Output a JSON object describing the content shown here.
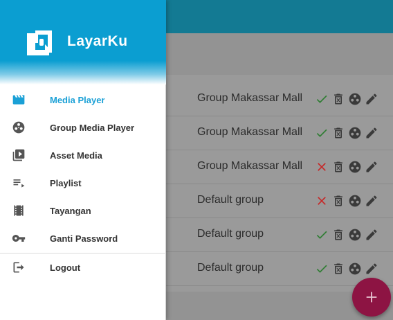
{
  "app": {
    "name": "LayarKu"
  },
  "drawer": {
    "items": [
      {
        "label": "Media Player",
        "icon": "clapperboard-icon",
        "active": true
      },
      {
        "label": "Group Media Player",
        "icon": "film-reel-icon",
        "active": false
      },
      {
        "label": "Asset Media",
        "icon": "video-library-icon",
        "active": false
      },
      {
        "label": "Playlist",
        "icon": "playlist-icon",
        "active": false
      },
      {
        "label": "Tayangan",
        "icon": "film-strip-icon",
        "active": false
      },
      {
        "label": "Ganti Password",
        "icon": "key-icon",
        "active": false
      }
    ],
    "logout_label": "Logout"
  },
  "table": {
    "rows": [
      {
        "group": "Group Makassar Mall",
        "status": "active"
      },
      {
        "group": "Group Makassar Mall",
        "status": "active"
      },
      {
        "group": "Group Makassar Mall",
        "status": "inactive"
      },
      {
        "group": "Default group",
        "status": "inactive"
      },
      {
        "group": "Default group",
        "status": "active"
      },
      {
        "group": "Default group",
        "status": "active"
      }
    ]
  },
  "colors": {
    "primary": "#0b9ed1",
    "accent": "#8d1443",
    "ok": "#2e7d32",
    "bad": "#c62828"
  }
}
